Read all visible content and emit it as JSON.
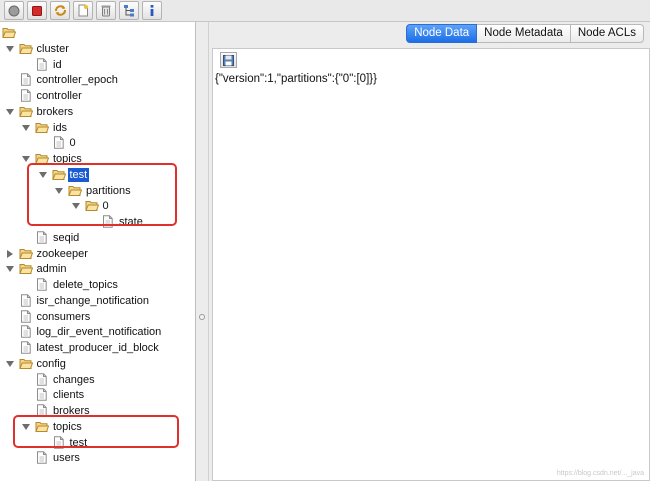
{
  "toolbar": {
    "buttons": [
      {
        "icon": "connect-icon"
      },
      {
        "icon": "disconnect-icon"
      },
      {
        "icon": "refresh-icon"
      },
      {
        "icon": "add-node-icon"
      },
      {
        "icon": "delete-node-icon"
      },
      {
        "icon": "tree-icon"
      },
      {
        "icon": "info-icon"
      }
    ]
  },
  "tree": {
    "nodes": [
      {
        "label": "",
        "depth": 0,
        "expanded": true,
        "type": "folder",
        "toggle": "none"
      },
      {
        "label": "cluster",
        "depth": 1,
        "type": "folder",
        "toggle": "open"
      },
      {
        "label": "id",
        "depth": 2,
        "type": "file",
        "toggle": "none"
      },
      {
        "label": "controller_epoch",
        "depth": 1,
        "type": "file",
        "toggle": "none"
      },
      {
        "label": "controller",
        "depth": 1,
        "type": "file",
        "toggle": "none"
      },
      {
        "label": "brokers",
        "depth": 1,
        "type": "folder",
        "toggle": "open"
      },
      {
        "label": "ids",
        "depth": 2,
        "type": "folder",
        "toggle": "open"
      },
      {
        "label": "0",
        "depth": 3,
        "type": "file",
        "toggle": "none"
      },
      {
        "label": "topics",
        "depth": 2,
        "type": "folder",
        "toggle": "open"
      },
      {
        "label": "test",
        "depth": 3,
        "type": "folder",
        "toggle": "open",
        "selected": true
      },
      {
        "label": "partitions",
        "depth": 4,
        "type": "folder",
        "toggle": "open"
      },
      {
        "label": "0",
        "depth": 5,
        "type": "folder",
        "toggle": "open"
      },
      {
        "label": "state",
        "depth": 6,
        "type": "file",
        "toggle": "none"
      },
      {
        "label": "seqid",
        "depth": 2,
        "type": "file",
        "toggle": "none"
      },
      {
        "label": "zookeeper",
        "depth": 1,
        "type": "folder",
        "toggle": "closed"
      },
      {
        "label": "admin",
        "depth": 1,
        "type": "folder",
        "toggle": "open"
      },
      {
        "label": "delete_topics",
        "depth": 2,
        "type": "file",
        "toggle": "none"
      },
      {
        "label": "isr_change_notification",
        "depth": 1,
        "type": "file",
        "toggle": "none"
      },
      {
        "label": "consumers",
        "depth": 1,
        "type": "file",
        "toggle": "none"
      },
      {
        "label": "log_dir_event_notification",
        "depth": 1,
        "type": "file",
        "toggle": "none"
      },
      {
        "label": "latest_producer_id_block",
        "depth": 1,
        "type": "file",
        "toggle": "none"
      },
      {
        "label": "config",
        "depth": 1,
        "type": "folder",
        "toggle": "open"
      },
      {
        "label": "changes",
        "depth": 2,
        "type": "file",
        "toggle": "none"
      },
      {
        "label": "clients",
        "depth": 2,
        "type": "file",
        "toggle": "none"
      },
      {
        "label": "brokers",
        "depth": 2,
        "type": "file",
        "toggle": "none"
      },
      {
        "label": "topics",
        "depth": 2,
        "type": "folder",
        "toggle": "open"
      },
      {
        "label": "test",
        "depth": 3,
        "type": "file",
        "toggle": "none"
      },
      {
        "label": "users",
        "depth": 2,
        "type": "file",
        "toggle": "none"
      }
    ]
  },
  "tabs": {
    "node_data": "Node Data",
    "node_metadata": "Node Metadata",
    "node_acls": "Node ACLs"
  },
  "content": {
    "node_data_text": "{\"version\":1,\"partitions\":{\"0\":[0]}}"
  },
  "colors": {
    "highlight": "#e0302b",
    "selection": "#1a5bd1",
    "active_tab": "#1c6ee8"
  },
  "watermark": "https://blog.csdn.net/..._java"
}
